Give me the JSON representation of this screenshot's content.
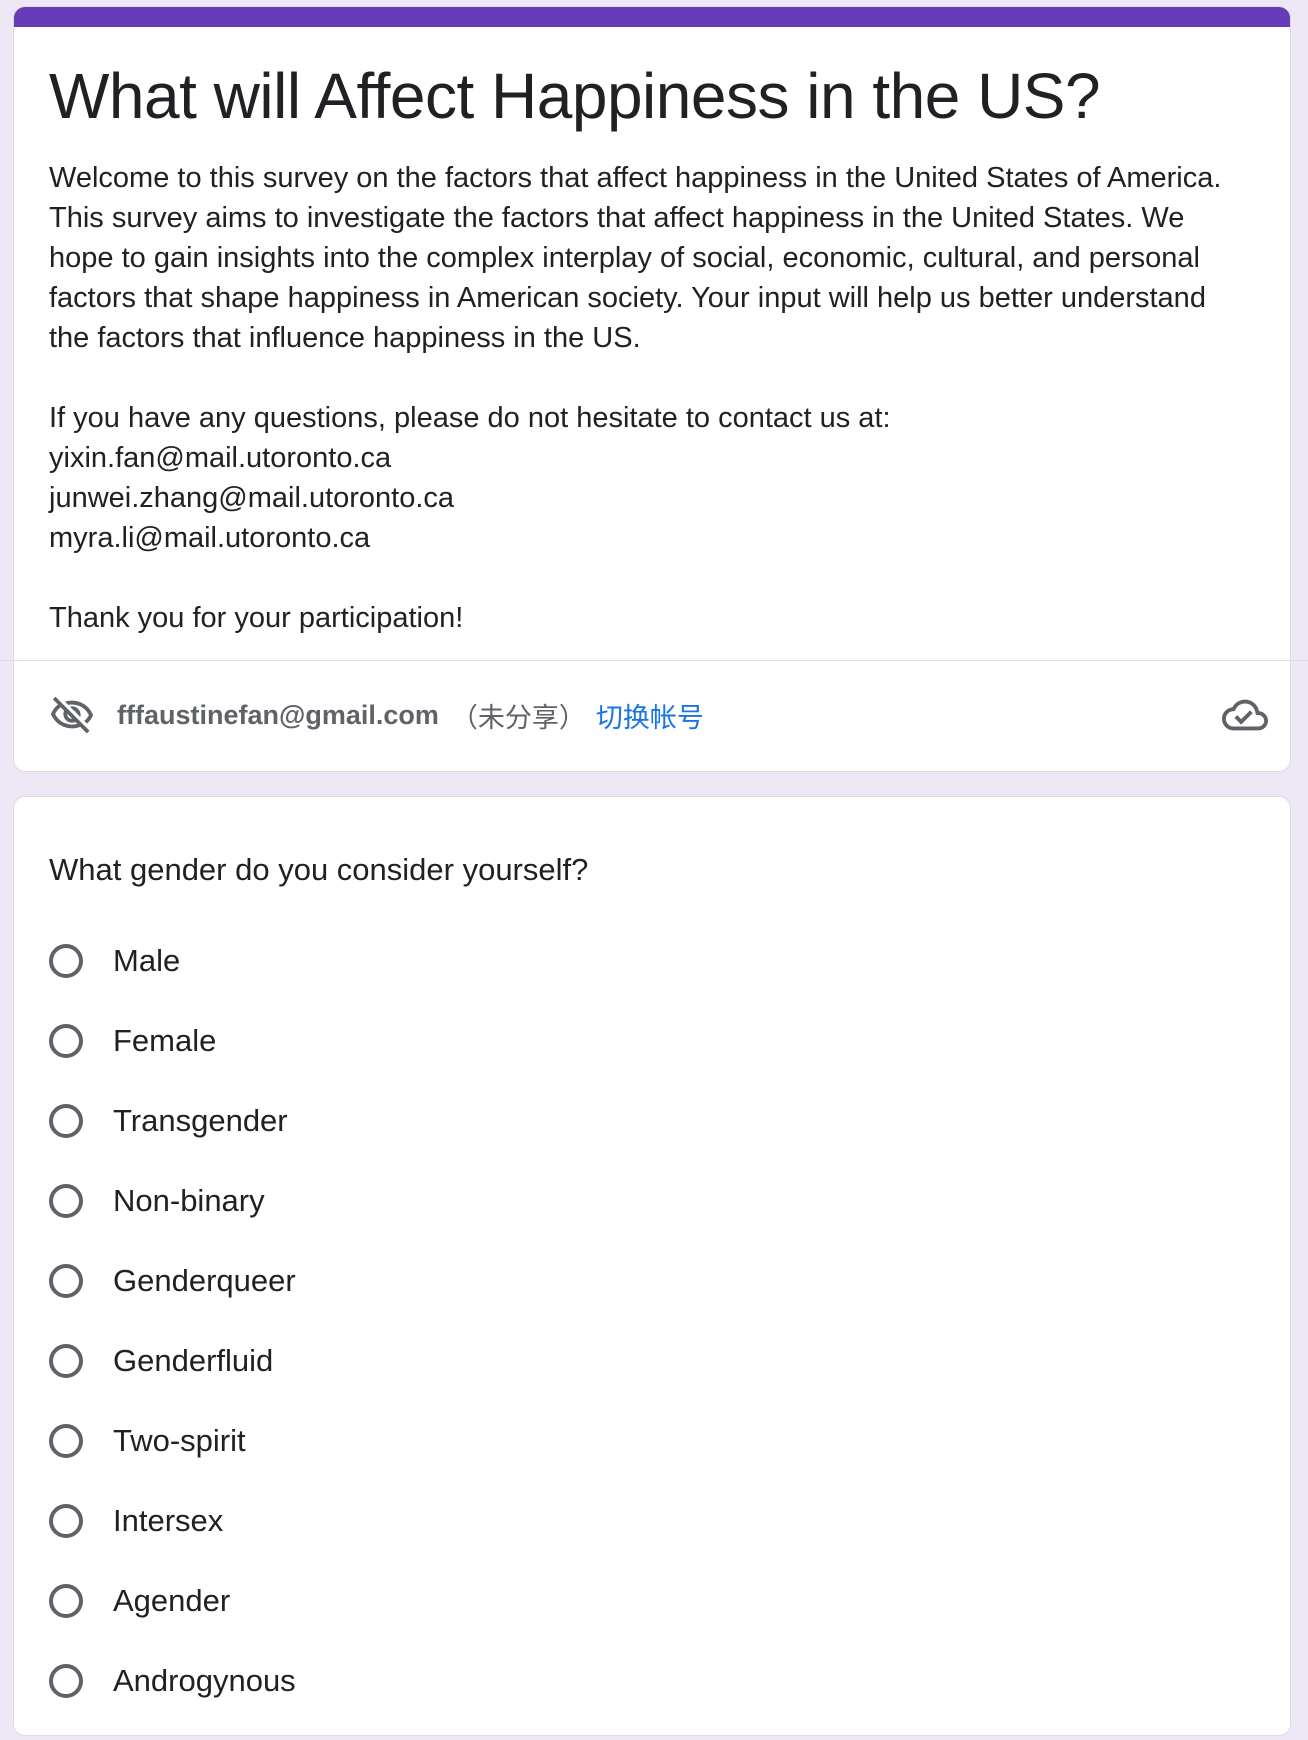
{
  "theme": {
    "accent": "#673ab7",
    "background": "#ede7f6",
    "link": "#1a73e8"
  },
  "form": {
    "title": "What will Affect Happiness in the US?",
    "description": {
      "intro": "Welcome to this survey on the factors that affect happiness in the United States of America. This survey aims to investigate the factors that affect happiness in the United States. We hope to gain insights into the complex interplay of social, economic, cultural, and personal factors that shape happiness in American society. Your input will help us better understand the factors that influence happiness in the US.",
      "contact_prompt": "If you have any questions, please do not hesitate to contact us at:",
      "emails": [
        "yixin.fan@mail.utoronto.ca",
        "junwei.zhang@mail.utoronto.ca",
        "myra.li@mail.utoronto.ca"
      ],
      "thanks": "Thank you for your participation!"
    }
  },
  "account": {
    "icon": "eye-off-icon",
    "email": "fffaustinefan@gmail.com",
    "unshared_note": "（未分享）",
    "switch_label": "切换帐号",
    "status_icon": "cloud-check-icon"
  },
  "question": {
    "text": "What gender do you consider yourself?",
    "options": [
      "Male",
      "Female",
      "Transgender",
      "Non-binary",
      "Genderqueer",
      "Genderfluid",
      "Two-spirit",
      "Intersex",
      "Agender",
      "Androgynous"
    ]
  }
}
